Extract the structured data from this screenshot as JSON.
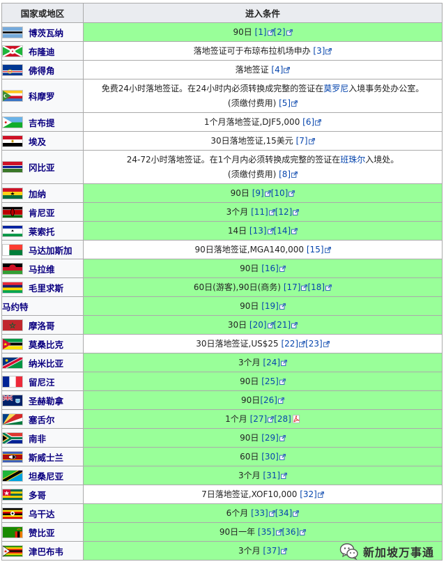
{
  "table": {
    "header_country": "国家或地区",
    "header_condition": "进入条件",
    "rows": [
      {
        "name": "博茨瓦纳",
        "flag": "botswana",
        "bg": "green",
        "tall": false,
        "segments": [
          {
            "t": "90日 "
          },
          {
            "r": "[1]"
          },
          {
            "r": "[2]"
          }
        ]
      },
      {
        "name": "布隆迪",
        "flag": "burundi",
        "bg": "white",
        "tall": false,
        "segments": [
          {
            "t": "落地签证可于布琼布拉机场申办 "
          },
          {
            "r": "[3]"
          }
        ]
      },
      {
        "name": "佛得角",
        "flag": "cape-verde",
        "bg": "white",
        "tall": false,
        "segments": [
          {
            "t": "落地签证 "
          },
          {
            "r": "[4]"
          }
        ]
      },
      {
        "name": "科摩罗",
        "flag": "comoros",
        "bg": "white",
        "tall": true,
        "segments": [
          {
            "t": "免费24小时落地签证。在24小时内必须转换成完整的签证在"
          },
          {
            "l": "莫罗尼"
          },
          {
            "t": "入境事务处办公室。"
          },
          {
            "br": true
          },
          {
            "t": "(须缴付费用) "
          },
          {
            "r": "[5]"
          }
        ]
      },
      {
        "name": "吉布提",
        "flag": "djibouti",
        "bg": "white",
        "tall": false,
        "segments": [
          {
            "t": "1个月落地签证,DJF5,000 "
          },
          {
            "r": "[6]"
          }
        ]
      },
      {
        "name": "埃及",
        "flag": "egypt",
        "bg": "white",
        "tall": false,
        "segments": [
          {
            "t": "30日落地签证,15美元 "
          },
          {
            "r": "[7]"
          }
        ]
      },
      {
        "name": "冈比亚",
        "flag": "gambia",
        "bg": "white",
        "tall": true,
        "segments": [
          {
            "t": "24-72小时落地签证。在1个月内必须转换成完整的签证在"
          },
          {
            "l": "班珠尔"
          },
          {
            "t": "入境处。"
          },
          {
            "br": true
          },
          {
            "t": "(须缴付费用) "
          },
          {
            "r": "[8]"
          }
        ]
      },
      {
        "name": "加纳",
        "flag": "ghana",
        "bg": "green",
        "tall": false,
        "segments": [
          {
            "t": "90日 "
          },
          {
            "r": "[9]"
          },
          {
            "r": "[10]"
          }
        ]
      },
      {
        "name": "肯尼亚",
        "flag": "kenya",
        "bg": "green",
        "tall": false,
        "segments": [
          {
            "t": "3个月 "
          },
          {
            "r": "[11]"
          },
          {
            "r": "[12]"
          }
        ]
      },
      {
        "name": "莱索托",
        "flag": "lesotho",
        "bg": "green",
        "tall": false,
        "segments": [
          {
            "t": "14日 "
          },
          {
            "r": "[13]"
          },
          {
            "r": "[14]"
          }
        ]
      },
      {
        "name": "马达加斯加",
        "flag": "madagascar",
        "bg": "white",
        "tall": false,
        "segments": [
          {
            "t": "90日落地签证,MGA140,000 "
          },
          {
            "r": "[15]"
          }
        ]
      },
      {
        "name": "马拉维",
        "flag": "malawi",
        "bg": "green",
        "tall": false,
        "segments": [
          {
            "t": "90日 "
          },
          {
            "r": "[16]"
          }
        ]
      },
      {
        "name": "毛里求斯",
        "flag": "mauritius",
        "bg": "green",
        "tall": false,
        "segments": [
          {
            "t": "60日(游客),90日(商务) "
          },
          {
            "r": "[17]"
          },
          {
            "r": "[18]"
          }
        ]
      },
      {
        "name": "马约特",
        "flag": "",
        "bg": "green",
        "tall": false,
        "segments": [
          {
            "t": "90日 "
          },
          {
            "r": "[19]"
          }
        ]
      },
      {
        "name": "摩洛哥",
        "flag": "morocco",
        "bg": "green",
        "tall": false,
        "segments": [
          {
            "t": "30日 "
          },
          {
            "r": "[20]"
          },
          {
            "r": "[21]"
          }
        ]
      },
      {
        "name": "莫桑比克",
        "flag": "mozambique",
        "bg": "white",
        "tall": false,
        "segments": [
          {
            "t": "30日落地签证,US$25 "
          },
          {
            "r": "[22]"
          },
          {
            "r": "[23]"
          }
        ]
      },
      {
        "name": "纳米比亚",
        "flag": "namibia",
        "bg": "green",
        "tall": false,
        "segments": [
          {
            "t": "3个月 "
          },
          {
            "r": "[24]"
          }
        ]
      },
      {
        "name": "留尼汪",
        "flag": "reunion",
        "bg": "green",
        "tall": false,
        "segments": [
          {
            "t": "90日 "
          },
          {
            "r": "[25]"
          }
        ]
      },
      {
        "name": "圣赫勒拿",
        "flag": "saint-helena",
        "bg": "green",
        "tall": false,
        "segments": [
          {
            "t": "90日"
          },
          {
            "r": "[26]"
          }
        ]
      },
      {
        "name": "塞舌尔",
        "flag": "seychelles",
        "bg": "green",
        "tall": false,
        "segments": [
          {
            "t": "1个月 "
          },
          {
            "r": "[27]"
          },
          {
            "r": "[28]",
            "pdf": true
          }
        ]
      },
      {
        "name": "南非",
        "flag": "south-africa",
        "bg": "green",
        "tall": false,
        "segments": [
          {
            "t": "90日 "
          },
          {
            "r": "[29]"
          }
        ]
      },
      {
        "name": "斯威士兰",
        "flag": "swaziland",
        "bg": "green",
        "tall": false,
        "segments": [
          {
            "t": "60日 "
          },
          {
            "r": "[30]"
          }
        ]
      },
      {
        "name": "坦桑尼亚",
        "flag": "tanzania",
        "bg": "green",
        "tall": false,
        "segments": [
          {
            "t": "3个月 "
          },
          {
            "r": "[31]"
          }
        ]
      },
      {
        "name": "多哥",
        "flag": "togo",
        "bg": "white",
        "tall": false,
        "segments": [
          {
            "t": "7日落地签证,XOF10,000 "
          },
          {
            "r": "[32]"
          }
        ]
      },
      {
        "name": "乌干达",
        "flag": "uganda",
        "bg": "green",
        "tall": false,
        "segments": [
          {
            "t": "6个月 "
          },
          {
            "r": "[33]"
          },
          {
            "r": "[34]"
          }
        ]
      },
      {
        "name": "赞比亚",
        "flag": "zambia",
        "bg": "green",
        "tall": false,
        "segments": [
          {
            "t": "90日一年 "
          },
          {
            "r": "[35]"
          },
          {
            "r": "[36]"
          }
        ]
      },
      {
        "name": "津巴布韦",
        "flag": "zimbabwe",
        "bg": "green",
        "tall": false,
        "segments": [
          {
            "t": "3个月 "
          },
          {
            "r": "[37]"
          }
        ]
      }
    ]
  },
  "colors": {
    "green_cell": "#99ff99",
    "header_bg": "#eaecf0",
    "name_bg": "#f8f9fa",
    "link": "#0645ad",
    "name_link": "#0b0080"
  },
  "watermark": {
    "text": "新加坡万事通",
    "icon": "wechat-icon"
  }
}
